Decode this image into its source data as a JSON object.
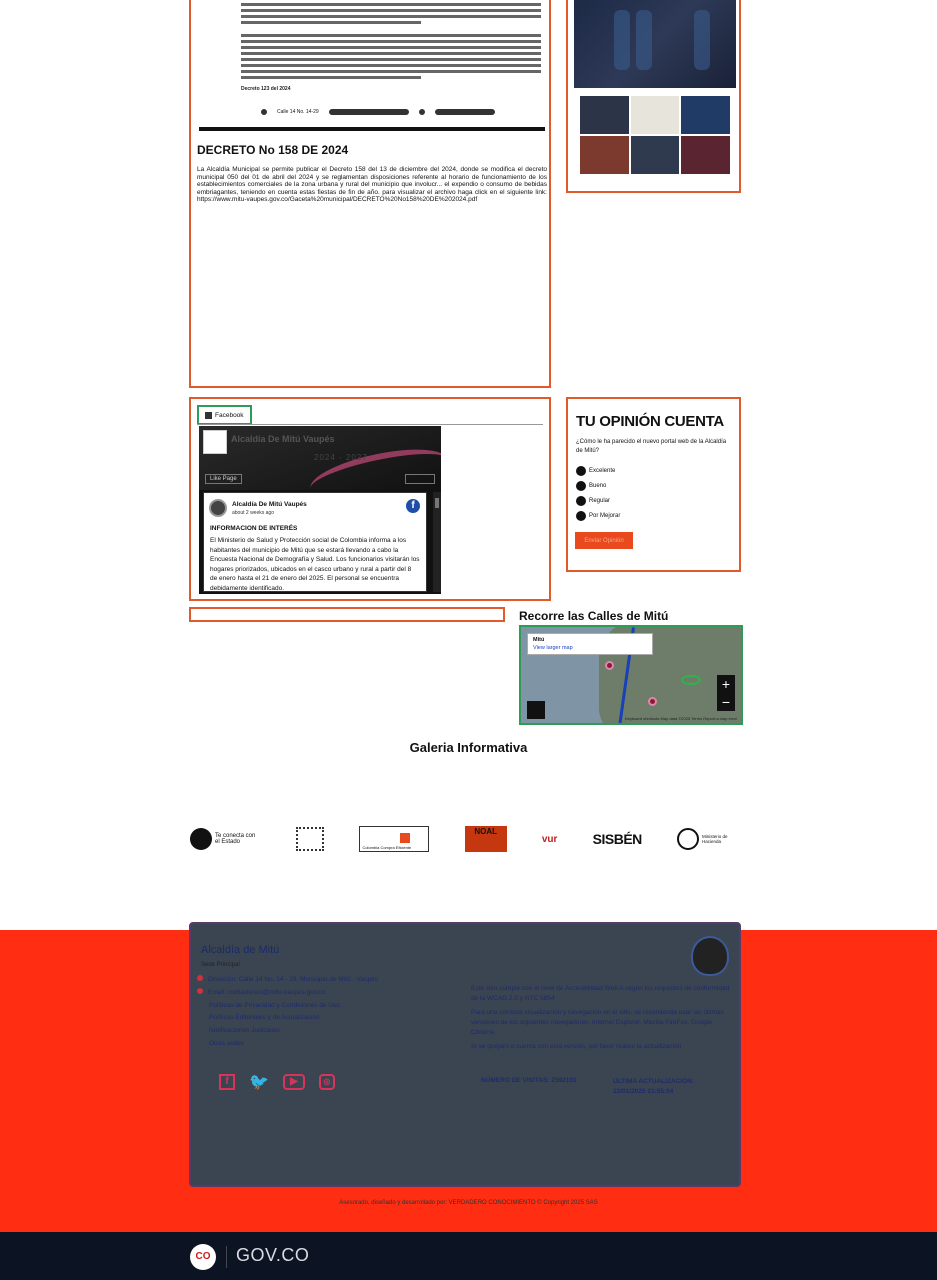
{
  "news": {
    "doc_footer_date": "Decreto 123 del 2024",
    "doc_address": "Calle 14 No. 14-29",
    "title": "DECRETO No 158 DE 2024",
    "body": "La Alcaldía Municipal se permite publicar el Decreto 158 del 13 de diciembre del 2024, donde se modifica el decreto municipal 050 del 01 de abril del 2024 y se reglamentan disposiciones referente al horario de funcionamiento de los establecimientos comerciales de la zona urbana y rural del municipio que involucr... el expendio o consumo de bebidas embriagantes, teniendo en cuenta estas fiestas de fin de año. para visualizar el archivo haga click en el siguiente link: https://www.mitu-vaupes.gov.co/Gaceta%20municipal/DECRETO%20No158%20DE%202024.pdf"
  },
  "facebook": {
    "tab_label": "Facebook",
    "page_name": "Alcaldía De Mitú Vaupés",
    "cover_text": "2024 - 2027",
    "like_label": "Like Page",
    "post_author": "Alcaldía De Mitú Vaupés",
    "post_time": "about 2 weeks ago",
    "post_heading": "INFORMACION DE INTERÉS",
    "post_text": "El Ministerio de Salud y Protección social de Colombia informa a los habitantes del municipio de Mitú que se estará llevando a cabo la Encuesta Nacional de Demografía y Salud. Los funcionarios visitarán los hogares priorizados, ubicados en el casco urbano y rural a partir del 8 de enero hasta el 21 de enero del 2025. El personal se encuentra debidamente identificado."
  },
  "poll": {
    "title": "TU OPINIÓN CUENTA",
    "question": "¿Cómo le ha parecido el nuevo portal web de la Alcaldía de Mitú?",
    "options": [
      "Excelente",
      "Bueno",
      "Regular",
      "Por Mejorar"
    ],
    "submit_label": "Enviar Opinión"
  },
  "map": {
    "title": "Recorre las Calles de Mitú",
    "place": "Mitú",
    "link": "View larger map",
    "zoom_in": "+",
    "zoom_out": "−",
    "attribution": "Keyboard shortcuts  Map data ©2025  Terms  Report a map error"
  },
  "gallery_section_title": "Galeria Informativa",
  "logos": {
    "tucontacto": "Te conecta con el Estado",
    "colombia_compra": "Colombia Compra Eficiente",
    "noal": "NOAL",
    "vur": "vur",
    "sisben": "SISBÉN",
    "hacienda": "Ministerio de Hacienda"
  },
  "footer": {
    "name": "Alcaldía de Mitú",
    "sede": "Sede Principal",
    "items": [
      "Dirección: Calle 14 No. 14 - 29, Municipio de Mitú - Vaupés",
      "Email: contactenos@mitu-vaupes.gov.co",
      "Políticas de Privacidad y Condiciones de Uso.",
      "Políticas Editoriales y de Actualización.",
      "Notificaciones Judiciales.",
      "Otras sedes"
    ],
    "accessibility": "Este sitio cumple con el nivel de Accesibilidad Web A según los requisitos de conformidad de la WCAG 2.0 y NTC 5854",
    "browsers": "Para una correcta visualización y navegación en el sitio, se recomienda usar las últimas versiones de los siguientes navegadores: Internet Explorer, Mozilla FireFox, Google Chrome.",
    "contact": "Si se quejaro o cuenta con esta versión, por favor realice la actualización",
    "visits_label": "NÚMERO DE VISITAS: 2592191",
    "updated_label": "ÚLTIMA ACTUALIZACIÓN:",
    "updated_value": "23/01/2025 21:55:04"
  },
  "credit": "Asesorado, diseñado y desarrollado por: VERDADERO CONOCIMIENTO © Copyright 2025 SAS",
  "gov": {
    "co": "CO",
    "label": "GOV.CO"
  }
}
